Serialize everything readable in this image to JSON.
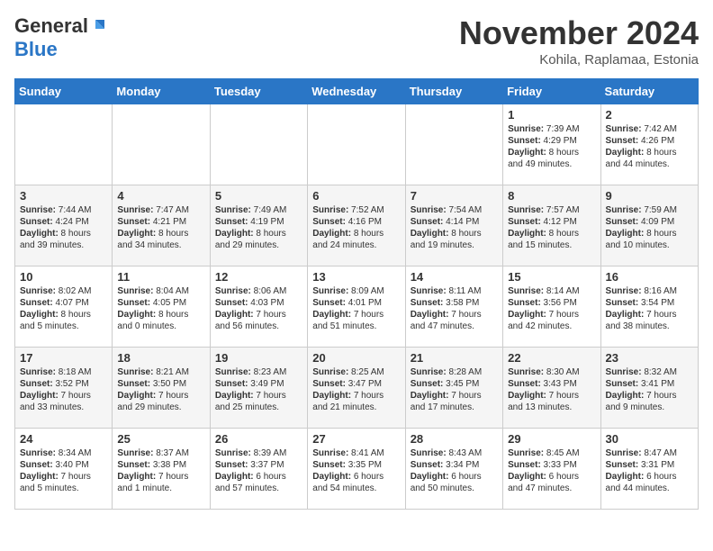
{
  "header": {
    "logo_general": "General",
    "logo_blue": "Blue",
    "month": "November 2024",
    "location": "Kohila, Raplamaa, Estonia"
  },
  "days_of_week": [
    "Sunday",
    "Monday",
    "Tuesday",
    "Wednesday",
    "Thursday",
    "Friday",
    "Saturday"
  ],
  "weeks": [
    [
      {
        "day": "",
        "info": ""
      },
      {
        "day": "",
        "info": ""
      },
      {
        "day": "",
        "info": ""
      },
      {
        "day": "",
        "info": ""
      },
      {
        "day": "",
        "info": ""
      },
      {
        "day": "1",
        "info": "Sunrise: 7:39 AM\nSunset: 4:29 PM\nDaylight: 8 hours and 49 minutes."
      },
      {
        "day": "2",
        "info": "Sunrise: 7:42 AM\nSunset: 4:26 PM\nDaylight: 8 hours and 44 minutes."
      }
    ],
    [
      {
        "day": "3",
        "info": "Sunrise: 7:44 AM\nSunset: 4:24 PM\nDaylight: 8 hours and 39 minutes."
      },
      {
        "day": "4",
        "info": "Sunrise: 7:47 AM\nSunset: 4:21 PM\nDaylight: 8 hours and 34 minutes."
      },
      {
        "day": "5",
        "info": "Sunrise: 7:49 AM\nSunset: 4:19 PM\nDaylight: 8 hours and 29 minutes."
      },
      {
        "day": "6",
        "info": "Sunrise: 7:52 AM\nSunset: 4:16 PM\nDaylight: 8 hours and 24 minutes."
      },
      {
        "day": "7",
        "info": "Sunrise: 7:54 AM\nSunset: 4:14 PM\nDaylight: 8 hours and 19 minutes."
      },
      {
        "day": "8",
        "info": "Sunrise: 7:57 AM\nSunset: 4:12 PM\nDaylight: 8 hours and 15 minutes."
      },
      {
        "day": "9",
        "info": "Sunrise: 7:59 AM\nSunset: 4:09 PM\nDaylight: 8 hours and 10 minutes."
      }
    ],
    [
      {
        "day": "10",
        "info": "Sunrise: 8:02 AM\nSunset: 4:07 PM\nDaylight: 8 hours and 5 minutes."
      },
      {
        "day": "11",
        "info": "Sunrise: 8:04 AM\nSunset: 4:05 PM\nDaylight: 8 hours and 0 minutes."
      },
      {
        "day": "12",
        "info": "Sunrise: 8:06 AM\nSunset: 4:03 PM\nDaylight: 7 hours and 56 minutes."
      },
      {
        "day": "13",
        "info": "Sunrise: 8:09 AM\nSunset: 4:01 PM\nDaylight: 7 hours and 51 minutes."
      },
      {
        "day": "14",
        "info": "Sunrise: 8:11 AM\nSunset: 3:58 PM\nDaylight: 7 hours and 47 minutes."
      },
      {
        "day": "15",
        "info": "Sunrise: 8:14 AM\nSunset: 3:56 PM\nDaylight: 7 hours and 42 minutes."
      },
      {
        "day": "16",
        "info": "Sunrise: 8:16 AM\nSunset: 3:54 PM\nDaylight: 7 hours and 38 minutes."
      }
    ],
    [
      {
        "day": "17",
        "info": "Sunrise: 8:18 AM\nSunset: 3:52 PM\nDaylight: 7 hours and 33 minutes."
      },
      {
        "day": "18",
        "info": "Sunrise: 8:21 AM\nSunset: 3:50 PM\nDaylight: 7 hours and 29 minutes."
      },
      {
        "day": "19",
        "info": "Sunrise: 8:23 AM\nSunset: 3:49 PM\nDaylight: 7 hours and 25 minutes."
      },
      {
        "day": "20",
        "info": "Sunrise: 8:25 AM\nSunset: 3:47 PM\nDaylight: 7 hours and 21 minutes."
      },
      {
        "day": "21",
        "info": "Sunrise: 8:28 AM\nSunset: 3:45 PM\nDaylight: 7 hours and 17 minutes."
      },
      {
        "day": "22",
        "info": "Sunrise: 8:30 AM\nSunset: 3:43 PM\nDaylight: 7 hours and 13 minutes."
      },
      {
        "day": "23",
        "info": "Sunrise: 8:32 AM\nSunset: 3:41 PM\nDaylight: 7 hours and 9 minutes."
      }
    ],
    [
      {
        "day": "24",
        "info": "Sunrise: 8:34 AM\nSunset: 3:40 PM\nDaylight: 7 hours and 5 minutes."
      },
      {
        "day": "25",
        "info": "Sunrise: 8:37 AM\nSunset: 3:38 PM\nDaylight: 7 hours and 1 minute."
      },
      {
        "day": "26",
        "info": "Sunrise: 8:39 AM\nSunset: 3:37 PM\nDaylight: 6 hours and 57 minutes."
      },
      {
        "day": "27",
        "info": "Sunrise: 8:41 AM\nSunset: 3:35 PM\nDaylight: 6 hours and 54 minutes."
      },
      {
        "day": "28",
        "info": "Sunrise: 8:43 AM\nSunset: 3:34 PM\nDaylight: 6 hours and 50 minutes."
      },
      {
        "day": "29",
        "info": "Sunrise: 8:45 AM\nSunset: 3:33 PM\nDaylight: 6 hours and 47 minutes."
      },
      {
        "day": "30",
        "info": "Sunrise: 8:47 AM\nSunset: 3:31 PM\nDaylight: 6 hours and 44 minutes."
      }
    ]
  ]
}
